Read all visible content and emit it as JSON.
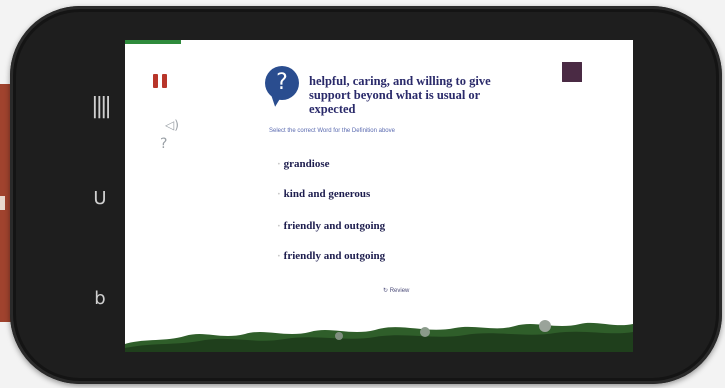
{
  "colors": {
    "pause": "#b8352a",
    "question_bubble": "#2a4d8f",
    "timer": "#4a2a44",
    "progress": "#2e8b3c",
    "definition_text": "#2a2a6a"
  },
  "nav_buttons": [
    {
      "icon": "menu-icon",
      "glyph": "||||"
    },
    {
      "icon": "home-icon",
      "glyph": "U"
    },
    {
      "icon": "back-icon",
      "glyph": "b"
    }
  ],
  "toolbar": {
    "pause_icon": "pause-icon",
    "sound_label": "◁)",
    "help_label": "?"
  },
  "quiz": {
    "progress": 0.11,
    "question_symbol": "?",
    "definition": "helpful, caring, and willing to give support beyond what is usual or expected",
    "instruction": "Select the correct Word for the Definition above",
    "timer_elapsed_fraction": 0.75,
    "options": [
      {
        "bullet": "·",
        "text": "grandiose"
      },
      {
        "bullet": "·",
        "text": "kind and generous"
      },
      {
        "bullet": "·",
        "text": "friendly and outgoing"
      },
      {
        "bullet": "·",
        "text": "friendly and outgoing"
      }
    ],
    "review_label": "Review"
  }
}
